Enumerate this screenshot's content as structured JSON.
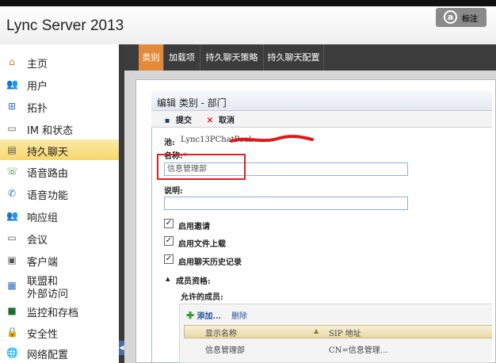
{
  "app": {
    "title": "Lync Server 2013",
    "tag_icon": "a",
    "tag_label": "标注"
  },
  "sidebar": {
    "items": [
      {
        "label": "主页",
        "icon": "home-icon",
        "glyph": "⌂"
      },
      {
        "label": "用户",
        "icon": "users-icon",
        "glyph": "👥"
      },
      {
        "label": "拓扑",
        "icon": "topology-icon",
        "glyph": "⊞"
      },
      {
        "label": "IM 和状态",
        "icon": "im-icon",
        "glyph": "▭"
      },
      {
        "label": "持久聊天",
        "icon": "persistent-chat-icon",
        "glyph": "▤",
        "active": true
      },
      {
        "label": "语音路由",
        "icon": "voice-routing-icon",
        "glyph": "☏"
      },
      {
        "label": "语音功能",
        "icon": "voice-features-icon",
        "glyph": "✆"
      },
      {
        "label": "响应组",
        "icon": "response-group-icon",
        "glyph": "👥"
      },
      {
        "label": "会议",
        "icon": "conferencing-icon",
        "glyph": "▭"
      },
      {
        "label": "客户端",
        "icon": "clients-icon",
        "glyph": "▣"
      },
      {
        "label": "联盟和",
        "label2": "外部访问",
        "icon": "federation-icon",
        "glyph": "▦"
      },
      {
        "label": "监控和存档",
        "icon": "monitoring-icon",
        "glyph": "■"
      },
      {
        "label": "安全性",
        "icon": "security-icon",
        "glyph": "🔒"
      },
      {
        "label": "网络配置",
        "icon": "network-icon",
        "glyph": "🌐"
      }
    ]
  },
  "tabs": [
    {
      "label": "类别",
      "active": true
    },
    {
      "label": "加载项"
    },
    {
      "label": "持久聊天策略"
    },
    {
      "label": "持久聊天配置"
    }
  ],
  "form": {
    "title": "编辑 类别 - 部门",
    "commit_label": "提交",
    "cancel_label": "取消",
    "pool_label": "池:",
    "pool_value": "Lync13PChatPool.",
    "name_label": "名称:",
    "name_required_mark": "*",
    "name_value": "信息管理部",
    "description_label": "说明:",
    "description_value": "",
    "checkboxes": [
      {
        "label": "启用邀请",
        "checked": true
      },
      {
        "label": "启用文件上载",
        "checked": true
      },
      {
        "label": "启用聊天历史记录",
        "checked": true
      }
    ],
    "membership_label": "成员资格:",
    "allowed_members_label": "允许的成员:",
    "add_label": "添加...",
    "remove_label": "删除",
    "grid": {
      "columns": [
        "显示名称",
        "SIP 地址"
      ],
      "rows": [
        [
          "信息管理部",
          "CN=信息管理..."
        ]
      ]
    }
  }
}
